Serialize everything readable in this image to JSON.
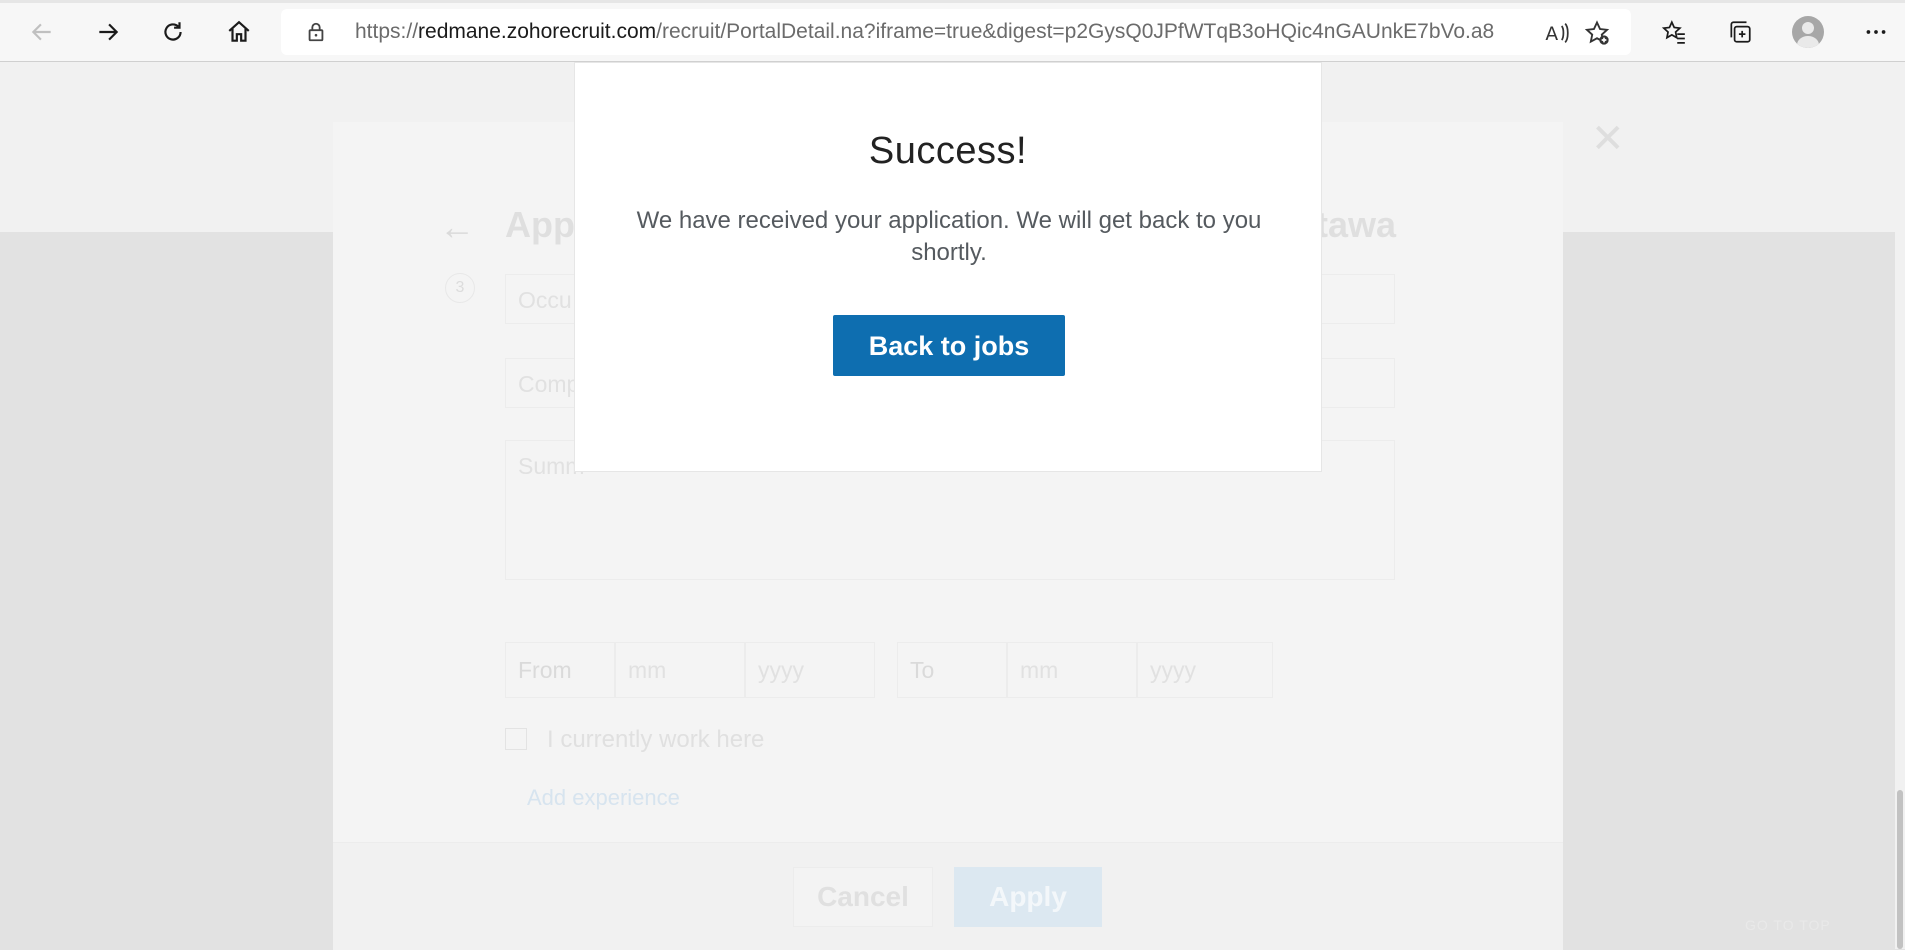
{
  "browser": {
    "url_scheme": "https://",
    "url_host": "redmane.zohorecruit.com",
    "url_rest": "/recruit/PortalDetail.na?iframe=true&digest=p2GysQ0JPfWTqB3oHQic4nGAUnkE7bVo.a85...",
    "icons": [
      "back-icon",
      "forward-icon",
      "refresh-icon",
      "home-icon",
      "lock-icon",
      "read-aloud-icon",
      "add-favorite-icon",
      "favorites-icon",
      "collections-icon",
      "profile-icon",
      "more-icon"
    ]
  },
  "background_form": {
    "heading_left": "Appl",
    "heading_right": "tawa",
    "step_number": "3",
    "fields": {
      "occupation_placeholder": "Occu",
      "company_placeholder": "Comp",
      "summary_placeholder": "Summ"
    },
    "date_row": {
      "from_label": "From",
      "from_month": "mm",
      "from_year": "yyyy",
      "to_label": "To",
      "to_month": "mm",
      "to_year": "yyyy"
    },
    "current_work_label": "I currently work here",
    "add_experience_label": "Add experience",
    "cancel_label": "Cancel",
    "apply_label": "Apply",
    "go_to_top_label": "GO TO TOP"
  },
  "modal": {
    "title": "Success!",
    "message": "We have received your application. We will get back to you shortly.",
    "button_label": "Back to jobs",
    "button_color": "#0e6eb0"
  }
}
